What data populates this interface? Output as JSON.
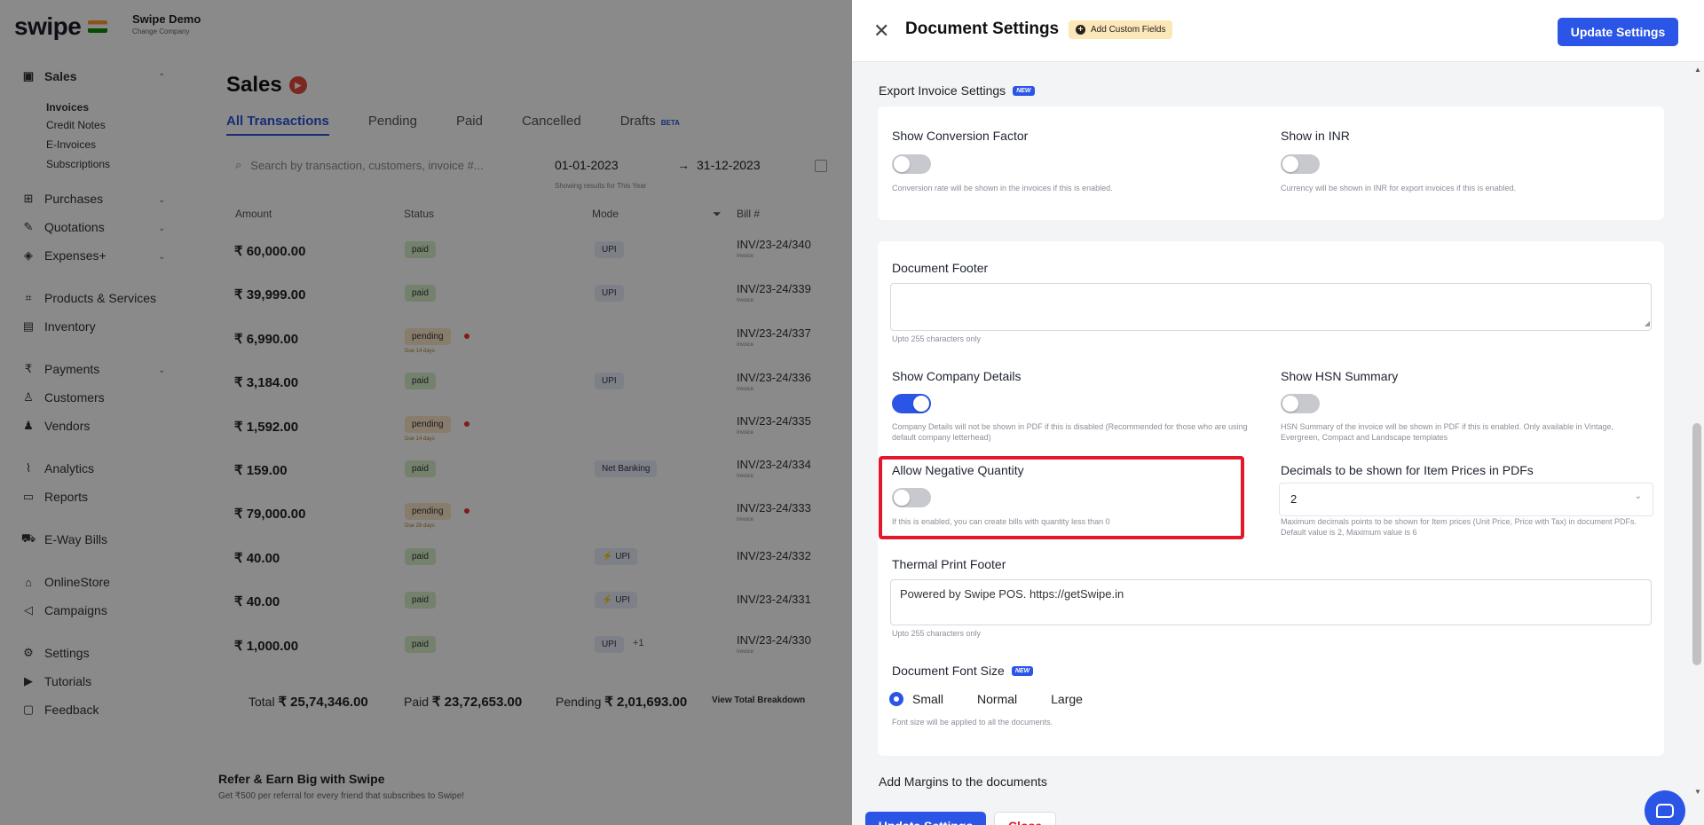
{
  "brand": {
    "logo": "swipe",
    "company_name": "Swipe Demo",
    "company_sub": "Change Company"
  },
  "sidebar": {
    "sales": "Sales",
    "sales_items": [
      "Invoices",
      "Credit Notes",
      "E-Invoices",
      "Subscriptions"
    ],
    "purchases": "Purchases",
    "quotations": "Quotations",
    "expenses": "Expenses+",
    "products": "Products & Services",
    "inventory": "Inventory",
    "payments": "Payments",
    "customers": "Customers",
    "vendors": "Vendors",
    "analytics": "Analytics",
    "reports": "Reports",
    "eway": "E-Way Bills",
    "onlinestore": "OnlineStore",
    "campaigns": "Campaigns",
    "settings": "Settings",
    "tutorials": "Tutorials",
    "feedback": "Feedback"
  },
  "sales": {
    "title": "Sales",
    "tabs": [
      "All Transactions",
      "Pending",
      "Paid",
      "Cancelled",
      "Drafts"
    ],
    "drafts_badge": "BETA",
    "search_placeholder": "Search by transaction, customers, invoice #...",
    "date_from": "01-01-2023",
    "date_to": "31-12-2023",
    "date_note": "Showing results for This Year",
    "headers": {
      "amount": "Amount",
      "status": "Status",
      "mode": "Mode",
      "bill": "Bill #"
    },
    "rows": [
      {
        "amount": "₹ 60,000.00",
        "status": "paid",
        "mode": "UPI",
        "bill": "INV/23-24/340",
        "bill_sub": "Invoice"
      },
      {
        "amount": "₹ 39,999.00",
        "status": "paid",
        "mode": "UPI",
        "bill": "INV/23-24/339",
        "bill_sub": "Invoice"
      },
      {
        "amount": "₹ 6,990.00",
        "status": "pending",
        "status_sub": "Due 14 days",
        "mode": "",
        "bill": "INV/23-24/337",
        "bill_sub": "Invoice"
      },
      {
        "amount": "₹ 3,184.00",
        "status": "paid",
        "mode": "UPI",
        "bill": "INV/23-24/336",
        "bill_sub": "Invoice"
      },
      {
        "amount": "₹ 1,592.00",
        "status": "pending",
        "status_sub": "Due 14 days",
        "mode": "",
        "bill": "INV/23-24/335",
        "bill_sub": "Invoice"
      },
      {
        "amount": "₹ 159.00",
        "status": "paid",
        "mode": "Net Banking",
        "bill": "INV/23-24/334",
        "bill_sub": "Invoice"
      },
      {
        "amount": "₹ 79,000.00",
        "status": "pending",
        "status_sub": "Due 28 days",
        "mode": "",
        "bill": "INV/23-24/333",
        "bill_sub": "Invoice"
      },
      {
        "amount": "₹ 40.00",
        "status": "paid",
        "mode": "⚡ UPI",
        "bill": "INV/23-24/332",
        "bill_sub": "Invoice"
      },
      {
        "amount": "₹ 40.00",
        "status": "paid",
        "mode": "⚡ UPI",
        "bill": "INV/23-24/331",
        "bill_sub": "Invoice"
      },
      {
        "amount": "₹ 1,000.00",
        "status": "paid",
        "mode": "UPI",
        "mode_extra": "+1",
        "bill": "INV/23-24/330",
        "bill_sub": "Invoice"
      }
    ],
    "totals": {
      "total_label": "Total",
      "total_value": "₹ 25,74,346.00",
      "paid_label": "Paid",
      "paid_value": "₹ 23,72,653.00",
      "pending_label": "Pending",
      "pending_value": "₹ 2,01,693.00",
      "breakdown": "View Total Breakdown"
    },
    "refer_title": "Refer & Earn Big with Swipe",
    "refer_sub": "Get ₹500 per referral for every friend that subscribes to Swipe!"
  },
  "drawer": {
    "title": "Document Settings",
    "add_custom_fields": "Add Custom Fields",
    "update_button": "Update Settings",
    "close_button": "Close",
    "new_badge": "NEW",
    "export_section": "Export Invoice Settings",
    "show_conversion_factor": {
      "label": "Show Conversion Factor",
      "help": "Conversion rate will be shown in the invoices if this is enabled.",
      "on": false
    },
    "show_in_inr": {
      "label": "Show in INR",
      "help": "Currency will be shown in INR for export invoices if this is enabled.",
      "on": false
    },
    "document_footer": {
      "label": "Document Footer",
      "value": "",
      "help": "Upto 255 characters only"
    },
    "show_company_details": {
      "label": "Show Company Details",
      "help": "Company Details will not be shown in PDF if this is disabled (Recommended for those who are using default company letterhead)",
      "on": true
    },
    "show_hsn_summary": {
      "label": "Show HSN Summary",
      "help": "HSN Summary of the invoice will be shown in PDF if this is enabled. Only available in Vintage, Evergreen, Compact and Landscape templates",
      "on": false
    },
    "allow_negative_quantity": {
      "label": "Allow Negative Quantity",
      "help": "If this is enabled, you can create bills with quantity less than 0",
      "on": false
    },
    "decimals": {
      "label": "Decimals to be shown for Item Prices in PDFs",
      "value": "2",
      "help": "Maximum decimals points to be shown for Item prices (Unit Price, Price with Tax) in document PDFs. Default value is 2, Maximum value is 6"
    },
    "thermal_footer": {
      "label": "Thermal Print Footer",
      "value": "Powered by Swipe POS. https://getSwipe.in",
      "help": "Upto 255 characters only"
    },
    "font_size": {
      "label": "Document Font Size",
      "options": [
        "Small",
        "Normal",
        "Large"
      ],
      "selected": "Small",
      "help": "Font size will be applied to all the documents."
    },
    "margins_section": "Add Margins to the documents"
  },
  "colors": {
    "accent": "#2b55e6",
    "highlight": "#e3182c",
    "paid": "#d7f0c9",
    "pending": "#fbe8c8"
  },
  "icons": [
    "close-icon",
    "plus-circle-icon",
    "chevron-down-icon",
    "chat-icon",
    "play-icon",
    "search-icon",
    "calendar-icon",
    "filter-icon"
  ]
}
